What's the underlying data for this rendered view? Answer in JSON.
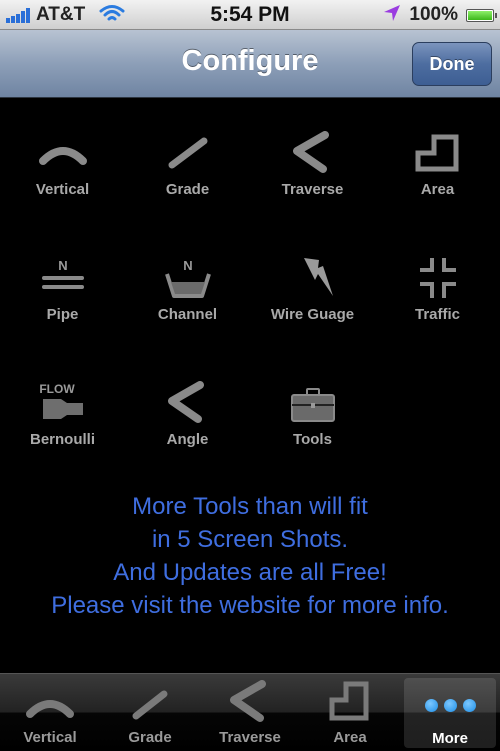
{
  "status_bar": {
    "carrier": "AT&T",
    "time": "5:54 PM",
    "battery_percent": "100%",
    "battery_level": 1.0,
    "signal_bars": 5,
    "icons": [
      "signal-bars-icon",
      "wifi-icon",
      "location-arrow-icon",
      "battery-icon"
    ]
  },
  "nav": {
    "title": "Configure",
    "done_label": "Done"
  },
  "tools": [
    {
      "label": "Vertical",
      "icon": "vertical-arc-icon"
    },
    {
      "label": "Grade",
      "icon": "grade-slope-icon"
    },
    {
      "label": "Traverse",
      "icon": "traverse-chevron-icon"
    },
    {
      "label": "Area",
      "icon": "area-shape-icon"
    },
    {
      "label": "Pipe",
      "icon": "pipe-icon",
      "icon_text": "N"
    },
    {
      "label": "Channel",
      "icon": "channel-icon",
      "icon_text": "N"
    },
    {
      "label": "Wire Guage",
      "icon": "lightning-bolt-icon"
    },
    {
      "label": "Traffic",
      "icon": "traffic-intersection-icon"
    },
    {
      "label": "Bernoulli",
      "icon": "flow-nozzle-icon",
      "icon_text": "FLOW"
    },
    {
      "label": "Angle",
      "icon": "angle-chevron-icon"
    },
    {
      "label": "Tools",
      "icon": "toolbox-icon"
    }
  ],
  "info_lines": [
    "More Tools than will fit",
    "in 5 Screen Shots.",
    "And Updates are all Free!",
    "Please visit the website for more info."
  ],
  "colors": {
    "info_text": "#3f6ee0",
    "more_dots": "#1e8ee6",
    "nav_bar": "#8d9fb8"
  },
  "tabbar": {
    "tabs": [
      {
        "label": "Vertical",
        "icon": "vertical-arc-icon",
        "active": false
      },
      {
        "label": "Grade",
        "icon": "grade-slope-icon",
        "active": false
      },
      {
        "label": "Traverse",
        "icon": "traverse-chevron-icon",
        "active": false
      },
      {
        "label": "Area",
        "icon": "area-shape-icon",
        "active": false
      },
      {
        "label": "More",
        "icon": "more-dots-icon",
        "active": true
      }
    ]
  }
}
